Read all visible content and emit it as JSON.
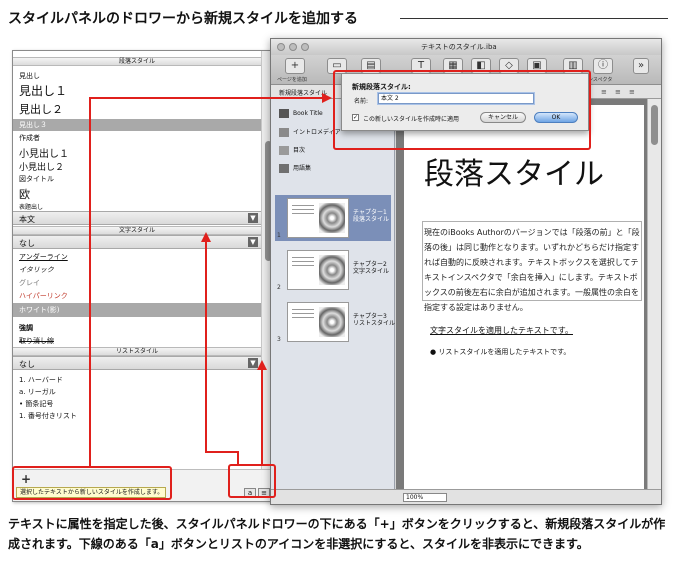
{
  "heading": "スタイルパネルのドロワーから新規スタイルを追加する",
  "caption": "テキストに属性を指定した後、スタイルパネルドロワーの下にある「+」ボタンをクリックすると、新規段落スタイルが作成されます。下線のある「a」ボタンとリストのアイコンを非選択にすると、スタイルを非表示にできます。",
  "drawer": {
    "paragraph_section": "段落スタイル",
    "paragraph_items": [
      "見出し",
      "見出し１",
      "見出し２",
      "見出し３",
      "作成者",
      "小見出し１",
      "小見出し２",
      "図タイトル",
      "欧",
      "表題出し"
    ],
    "paragraph_selected_value": "本文",
    "character_section": "文字スタイル",
    "character_selected_value": "なし",
    "character_items": [
      "アンダーライン",
      "イタリック",
      "グレイ",
      "ハイパーリンク",
      "ホワイト(影)",
      "強調",
      "取り消し線"
    ],
    "list_section": "リストスタイル",
    "list_selected_value": "なし",
    "list_items": [
      "1. ハーバード",
      "a. リーガル",
      "• 箇条記号",
      "1. 番号付きリスト"
    ],
    "plus_label": "+",
    "status_tip": "選択したテキストから新しいスタイルを作成します。",
    "btn_char": "a",
    "btn_list": "≡"
  },
  "window": {
    "title": "テキストのスタイル.iba",
    "toolbar": [
      {
        "icon": "+",
        "label": "ページを追加"
      },
      {
        "icon": "▭",
        "label": ""
      },
      {
        "icon": "▤",
        "label": ""
      },
      {
        "icon": "T",
        "label": ""
      },
      {
        "icon": "▦",
        "label": ""
      },
      {
        "icon": "◧",
        "label": ""
      },
      {
        "icon": "◇",
        "label": ""
      },
      {
        "icon": "▣",
        "label": ""
      },
      {
        "icon": "▥",
        "label": ""
      },
      {
        "icon": "ⓘ",
        "label": "インスペクタ"
      },
      {
        "icon": "»",
        "label": ""
      }
    ],
    "subbar_text": "新規段落スタイル",
    "sidebar": [
      {
        "icon": "book-icon",
        "label": "Book Title"
      },
      {
        "icon": "media-icon",
        "label": "イントロメディア"
      },
      {
        "icon": "toc-icon",
        "label": "目次"
      },
      {
        "icon": "glossary-icon",
        "label": "用語集"
      }
    ],
    "chapters": [
      {
        "num": "1",
        "caption": "チャプター1\n段落スタイル"
      },
      {
        "num": "2",
        "caption": "チャプター2\n文字スタイル"
      },
      {
        "num": "3",
        "caption": "チャプター3\nリストスタイル"
      }
    ],
    "page_title": "段落スタイル",
    "body_text": "現在のiBooks Authorのバージョンでは「段落の前」と「段落の後」は同じ動作となります。いずれかどちらだけ指定すれば自動的に反映されます。テキストボックスを選択してテキストインスペクタで「余白を挿入」にします。テキストボックスの前後左右に余白が追加されます。一般属性の余白を指定する設定はありません。",
    "char_line": "文字スタイルを適用したテキストです。",
    "list_line": "リストスタイルを適用したテキストです。",
    "zoom": "100%"
  },
  "dialog": {
    "title": "新規段落スタイル:",
    "name_label": "名前:",
    "name_value": "本文 2",
    "checkbox_label": "この新しいスタイルを作成時に適用",
    "checkbox_checked": true,
    "cancel_label": "キャンセル",
    "ok_label": "OK"
  },
  "colors": {
    "annotation": "#e0201c",
    "selection": "#7b8fb8"
  }
}
